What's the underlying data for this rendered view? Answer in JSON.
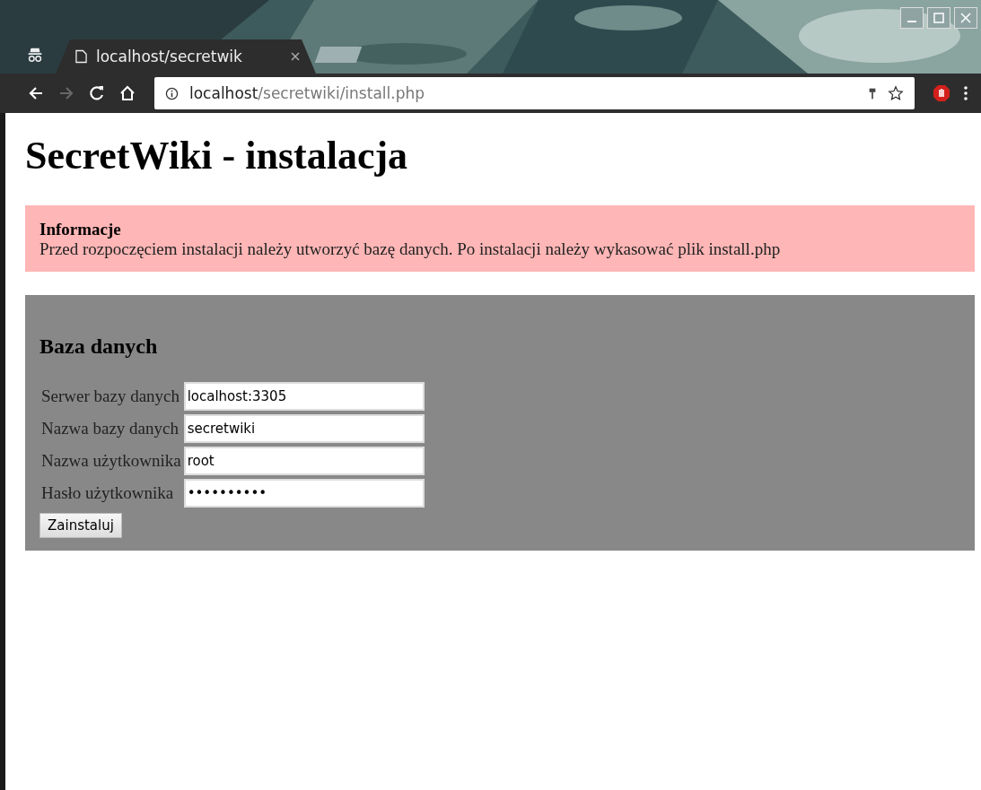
{
  "browser": {
    "tab": {
      "title": "localhost/secretwik",
      "selected": true
    },
    "address": {
      "host": "localhost",
      "path": "/secretwiki/install.php"
    }
  },
  "page": {
    "title": "SecretWiki - instalacja",
    "info": {
      "heading": "Informacje",
      "text": "Przed rozpoczęciem instalacji należy utworzyć bazę danych. Po instalacji należy wykasować plik install.php"
    },
    "form": {
      "heading": "Baza danych",
      "fields": [
        {
          "label": "Serwer bazy danych",
          "value": "localhost:3305"
        },
        {
          "label": "Nazwa bazy danych",
          "value": "secretwiki"
        },
        {
          "label": "Nazwa użytkownika",
          "value": "root"
        },
        {
          "label": "Hasło użytkownika",
          "value": "••••••••••"
        }
      ],
      "button": "Zainstaluj"
    }
  }
}
